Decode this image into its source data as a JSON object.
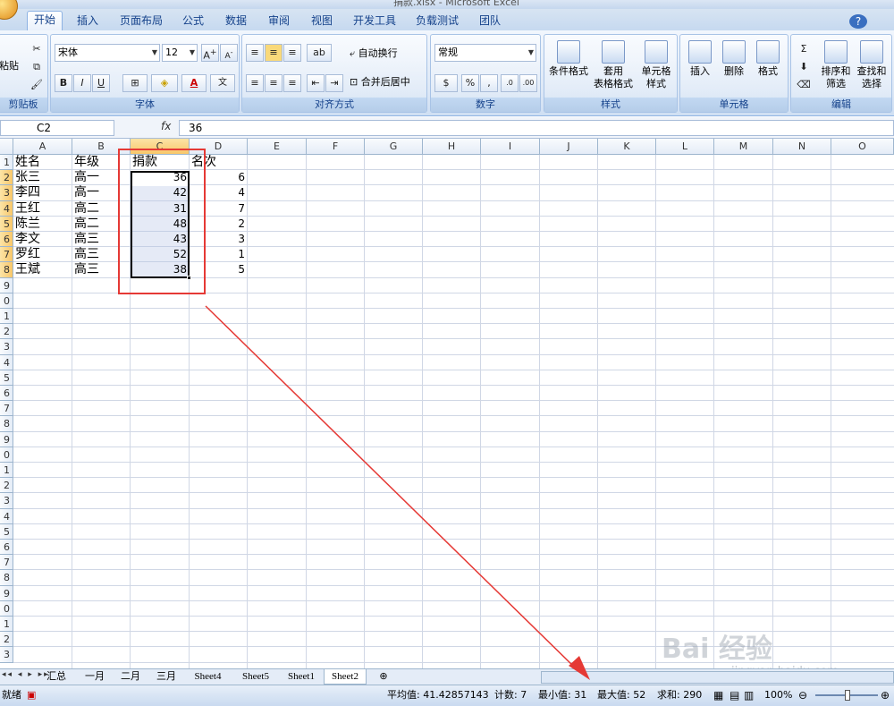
{
  "title": "捐款.xlsx - Microsoft Excel",
  "tabs": [
    "开始",
    "插入",
    "页面布局",
    "公式",
    "数据",
    "审阅",
    "视图",
    "开发工具",
    "负载测试",
    "团队"
  ],
  "ribbon": {
    "clipboard": {
      "paste": "粘贴",
      "label": "剪贴板"
    },
    "font": {
      "name": "宋体",
      "size": "12",
      "label": "字体",
      "bold": "B",
      "italic": "I",
      "underline": "U"
    },
    "alignment": {
      "wrap": "自动换行",
      "merge": "合并后居中",
      "label": "对齐方式"
    },
    "number": {
      "format": "常规",
      "percent": "%",
      "comma": ",",
      "label": "数字"
    },
    "styles": {
      "cond": "条件格式",
      "table1": "套用",
      "table2": "表格格式",
      "cell1": "单元格",
      "cell2": "样式",
      "label": "样式"
    },
    "cells": {
      "insert": "插入",
      "delete": "删除",
      "format": "格式",
      "label": "单元格"
    },
    "editing": {
      "sort1": "排序和",
      "sort2": "筛选",
      "find1": "查找和",
      "find2": "选择",
      "label": "编辑"
    }
  },
  "formula": {
    "namebox": "C2",
    "fx": "fx",
    "value": "36"
  },
  "columns": [
    "A",
    "B",
    "C",
    "D",
    "E",
    "F",
    "G",
    "H",
    "I",
    "J",
    "K",
    "L",
    "M",
    "N",
    "O"
  ],
  "rows": [
    "1",
    "2",
    "3",
    "4",
    "5",
    "6",
    "7",
    "8",
    "9",
    "0",
    "1",
    "2",
    "3",
    "4",
    "5",
    "6",
    "7",
    "8",
    "9",
    "0",
    "1",
    "2",
    "3",
    "4",
    "5",
    "6",
    "7",
    "8",
    "9",
    "0",
    "1",
    "2",
    "3"
  ],
  "table": {
    "header": [
      "姓名",
      "年级",
      "捐款",
      "名次"
    ],
    "data": [
      [
        "张三",
        "高一",
        "36",
        "6"
      ],
      [
        "李四",
        "高一",
        "42",
        "4"
      ],
      [
        "王红",
        "高二",
        "31",
        "7"
      ],
      [
        "陈兰",
        "高二",
        "48",
        "2"
      ],
      [
        "李文",
        "高三",
        "43",
        "3"
      ],
      [
        "罗红",
        "高三",
        "52",
        "1"
      ],
      [
        "王斌",
        "高三",
        "38",
        "5"
      ]
    ]
  },
  "sheets": [
    "汇总",
    "一月",
    "二月",
    "三月",
    "Sheet4",
    "Sheet5",
    "Sheet1",
    "Sheet2"
  ],
  "status": {
    "ready": "就绪",
    "avg": "平均值: 41.42857143",
    "count": "计数: 7",
    "min": "最小值: 31",
    "max": "最大值: 52",
    "sum": "求和: 290",
    "zoom": "100%"
  },
  "watermark": {
    "main": "Bai 经验",
    "url": "jingyan.baidu.com"
  },
  "colors": {
    "accent": "#15428b",
    "annotation": "#e53935",
    "selection": "#f8c76a"
  }
}
